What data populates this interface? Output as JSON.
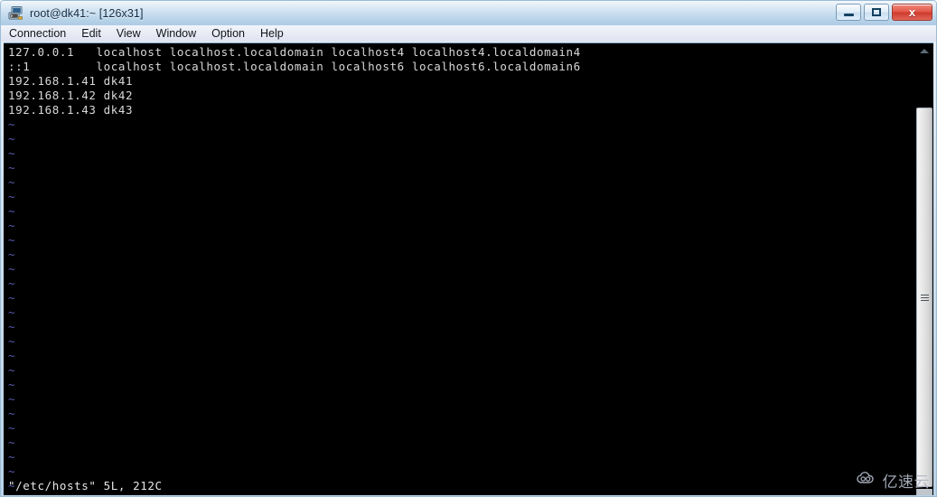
{
  "window": {
    "title": "root@dk41:~ [126x31]",
    "icon": "terminal-window-icon",
    "buttons": {
      "minimize": "–",
      "maximize": "□",
      "close": "x"
    }
  },
  "menubar": {
    "items": [
      {
        "label": "Connection",
        "name": "menu-connection"
      },
      {
        "label": "Edit",
        "name": "menu-edit"
      },
      {
        "label": "View",
        "name": "menu-view"
      },
      {
        "label": "Window",
        "name": "menu-window"
      },
      {
        "label": "Option",
        "name": "menu-option"
      },
      {
        "label": "Help",
        "name": "menu-help"
      }
    ]
  },
  "terminal": {
    "lines": [
      "127.0.0.1   localhost localhost.localdomain localhost4 localhost4.localdomain4",
      "::1         localhost localhost.localdomain localhost6 localhost6.localdomain6",
      "192.168.1.41 dk41",
      "192.168.1.42 dk42",
      "192.168.1.43 dk43"
    ],
    "empty_marker": "~",
    "empty_marker_count": 26,
    "status_line": "\"/etc/hosts\" 5L, 212C",
    "colors": {
      "background": "#000000",
      "foreground": "#d8d8d8",
      "tilde": "#5a5ab0"
    }
  },
  "scrollbar": {
    "up_arrow": "scroll-up-arrow",
    "thumb": "scroll-thumb"
  },
  "watermark": {
    "text": "亿速云",
    "logo": "cloud-logo-icon"
  }
}
